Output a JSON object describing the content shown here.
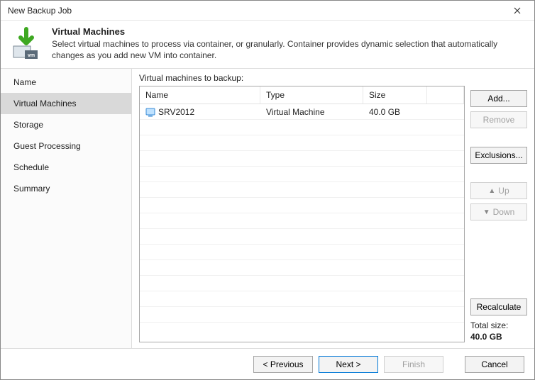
{
  "window": {
    "title": "New Backup Job"
  },
  "header": {
    "title": "Virtual Machines",
    "description": "Select virtual machines to process via container, or granularly. Container provides dynamic selection that automatically changes as you add new VM into container."
  },
  "sidebar": {
    "items": [
      {
        "label": "Name",
        "active": false
      },
      {
        "label": "Virtual Machines",
        "active": true
      },
      {
        "label": "Storage",
        "active": false
      },
      {
        "label": "Guest Processing",
        "active": false
      },
      {
        "label": "Schedule",
        "active": false
      },
      {
        "label": "Summary",
        "active": false
      }
    ]
  },
  "main": {
    "table_label": "Virtual machines to backup:",
    "columns": {
      "name": "Name",
      "type": "Type",
      "size": "Size"
    },
    "rows": [
      {
        "name": "SRV2012",
        "type": "Virtual Machine",
        "size": "40.0 GB"
      }
    ],
    "buttons": {
      "add": "Add...",
      "remove": "Remove",
      "exclusions": "Exclusions...",
      "up": "Up",
      "down": "Down",
      "recalculate": "Recalculate"
    },
    "total_label": "Total size:",
    "total_value": "40.0 GB"
  },
  "footer": {
    "previous": "< Previous",
    "next": "Next >",
    "finish": "Finish",
    "cancel": "Cancel"
  }
}
